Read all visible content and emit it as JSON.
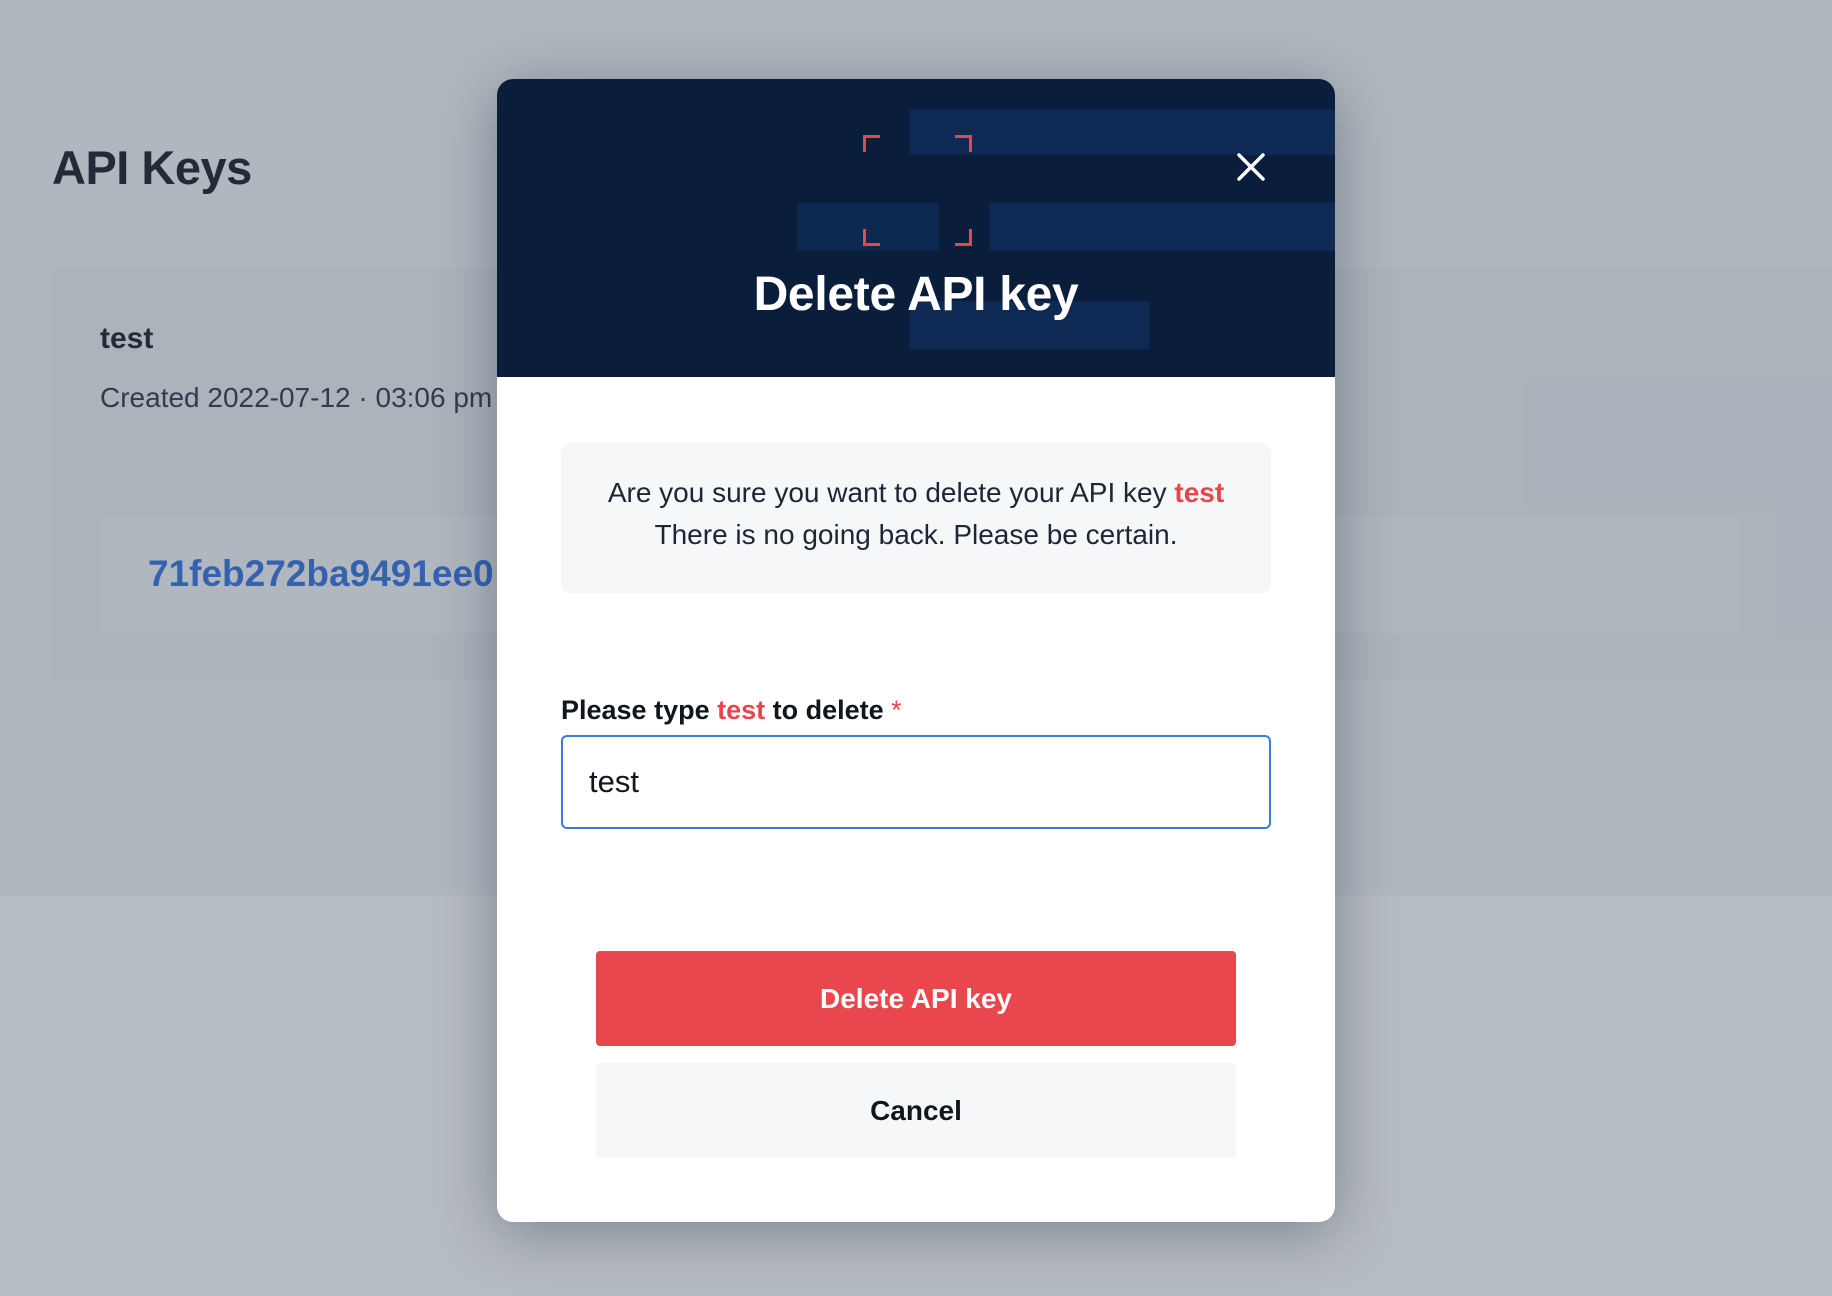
{
  "background": {
    "page_title": "API Keys",
    "key": {
      "name": "test",
      "created": "Created 2022-07-12 · 03:06 pm",
      "value": "71feb272ba9491ee0"
    }
  },
  "modal": {
    "title": "Delete API key",
    "close_icon": "close-icon",
    "warning": {
      "line1_prefix": "Are you sure you want to delete your API key ",
      "key_name": "test",
      "line2": "There is no going back. Please be certain."
    },
    "confirm": {
      "label_prefix": "Please type ",
      "label_key": "test",
      "label_suffix": " to delete",
      "required_marker": "*",
      "input_value": "test"
    },
    "delete_button_label": "Delete API key",
    "cancel_button_label": "Cancel"
  },
  "colors": {
    "header_bg": "#0a1d3b",
    "danger": "#ea464e",
    "accent_blue": "#2f6fe0"
  }
}
